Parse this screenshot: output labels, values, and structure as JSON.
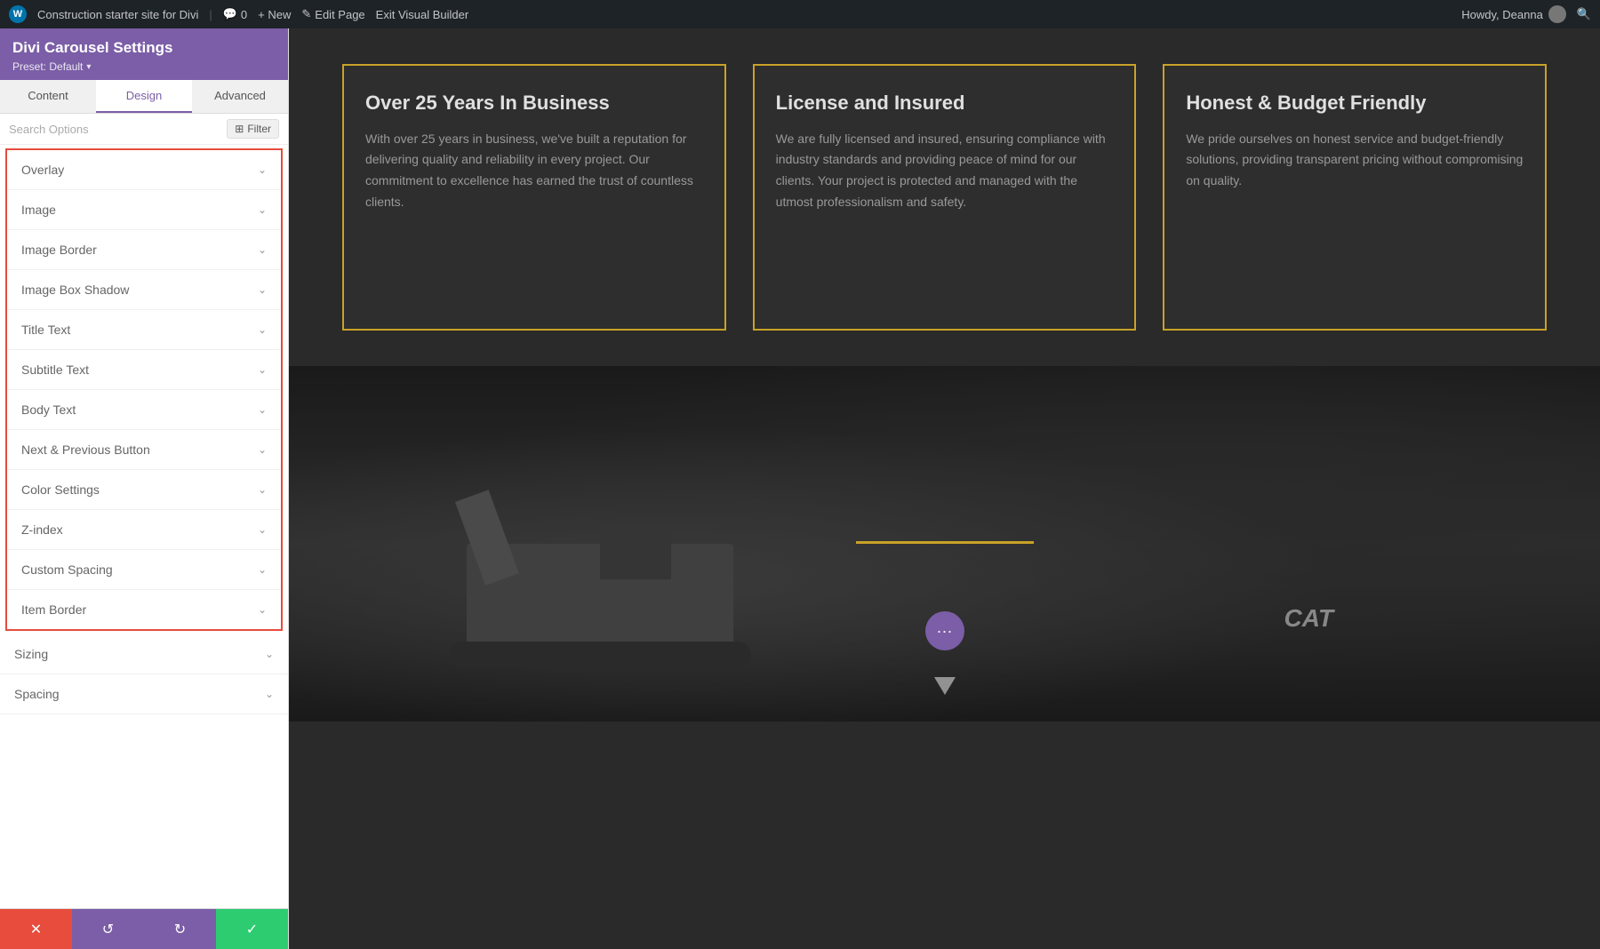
{
  "adminBar": {
    "siteName": "Construction starter site for Divi",
    "commentsCount": "0",
    "newLabel": "+ New",
    "editPageLabel": "Edit Page",
    "exitBuilderLabel": "Exit Visual Builder",
    "howdyLabel": "Howdy, Deanna"
  },
  "sidebar": {
    "moduleTitle": "Divi Carousel Settings",
    "presetLabel": "Preset: Default",
    "tabs": [
      {
        "id": "content",
        "label": "Content"
      },
      {
        "id": "design",
        "label": "Design"
      },
      {
        "id": "advanced",
        "label": "Advanced"
      }
    ],
    "activeTab": "design",
    "searchPlaceholder": "Search Options",
    "filterLabel": "Filter",
    "settingsInBorder": [
      {
        "id": "overlay",
        "label": "Overlay"
      },
      {
        "id": "image",
        "label": "Image"
      },
      {
        "id": "image-border",
        "label": "Image Border"
      },
      {
        "id": "image-box-shadow",
        "label": "Image Box Shadow"
      },
      {
        "id": "title-text",
        "label": "Title Text"
      },
      {
        "id": "subtitle-text",
        "label": "Subtitle Text"
      },
      {
        "id": "body-text",
        "label": "Body Text"
      },
      {
        "id": "next-prev-button",
        "label": "Next & Previous Button"
      },
      {
        "id": "color-settings",
        "label": "Color Settings"
      },
      {
        "id": "z-index",
        "label": "Z-index"
      },
      {
        "id": "custom-spacing",
        "label": "Custom Spacing"
      },
      {
        "id": "item-border",
        "label": "Item Border"
      }
    ],
    "settingsOutsideBorder": [
      {
        "id": "sizing",
        "label": "Sizing"
      },
      {
        "id": "spacing",
        "label": "Spacing"
      }
    ]
  },
  "toolbar": {
    "closeIcon": "✕",
    "undoIcon": "↺",
    "redoIcon": "↻",
    "saveIcon": "✓"
  },
  "cards": [
    {
      "title": "Over 25 Years In Business",
      "body": "With over 25 years in business, we've built a reputation for delivering quality and reliability in every project. Our commitment to excellence has earned the trust of countless clients."
    },
    {
      "title": "License and Insured",
      "body": "We are fully licensed and insured, ensuring compliance with industry standards and providing peace of mind for our clients. Your project is protected and managed with the utmost professionalism and safety."
    },
    {
      "title": "Honest & Budget Friendly",
      "body": "We pride ourselves on honest service and budget-friendly solutions, providing transparent pricing without compromising on quality."
    }
  ],
  "colors": {
    "sidebarPurple": "#7b5ea7",
    "cardBorder": "#c9a227",
    "redBorder": "#e74c3c",
    "saveGreen": "#2ecc71"
  }
}
